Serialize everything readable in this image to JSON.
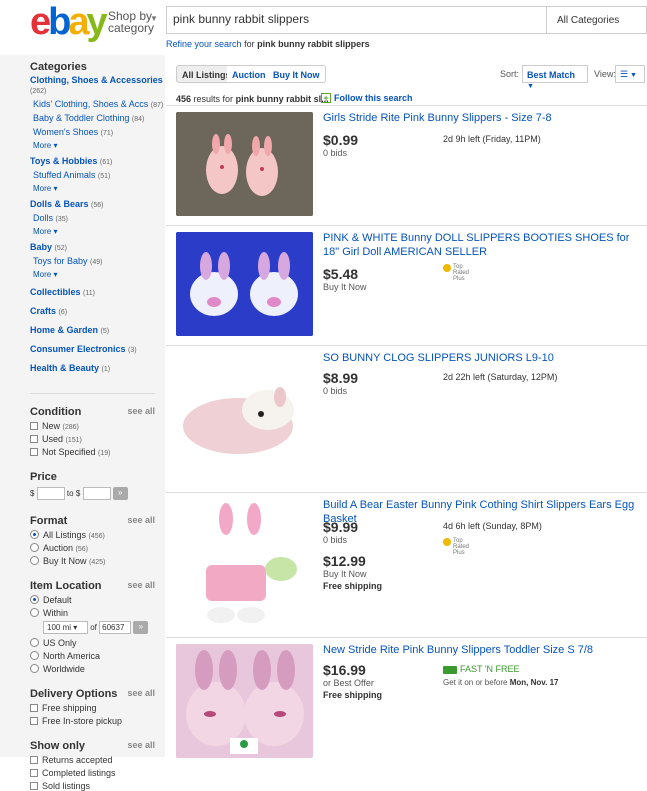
{
  "header": {
    "logo": {
      "e": "e",
      "b": "b",
      "a": "a",
      "y": "y"
    },
    "shop_by": "Shop by",
    "category": "category",
    "search_value": "pink bunny rabbit slippers",
    "category_select": "All Categories",
    "refine_prefix": "Refine your search",
    "refine_for": "for",
    "refine_query": "pink bunny rabbit slippers"
  },
  "sidebar": {
    "categories_heading": "Categories",
    "groups": [
      {
        "label": "Clothing, Shoes & Accessories",
        "count": "(262)",
        "subs": [
          {
            "label": "Kids' Clothing, Shoes & Accs",
            "count": "(87)"
          },
          {
            "label": "Baby & Toddler Clothing",
            "count": "(84)"
          },
          {
            "label": "Women's Shoes",
            "count": "(71)"
          }
        ],
        "more": "More"
      },
      {
        "label": "Toys & Hobbies",
        "count": "(61)",
        "subs": [
          {
            "label": "Stuffed Animals",
            "count": "(51)"
          }
        ],
        "more": "More"
      },
      {
        "label": "Dolls & Bears",
        "count": "(56)",
        "subs": [
          {
            "label": "Dolls",
            "count": "(35)"
          }
        ],
        "more": "More"
      },
      {
        "label": "Baby",
        "count": "(52)",
        "subs": [
          {
            "label": "Toys for Baby",
            "count": "(49)"
          }
        ],
        "more": "More"
      }
    ],
    "flat_categories": [
      {
        "label": "Collectibles",
        "count": "(11)"
      },
      {
        "label": "Crafts",
        "count": "(6)"
      },
      {
        "label": "Home & Garden",
        "count": "(5)"
      },
      {
        "label": "Consumer Electronics",
        "count": "(3)"
      },
      {
        "label": "Health & Beauty",
        "count": "(1)"
      }
    ],
    "see_all": "see all",
    "condition": {
      "heading": "Condition",
      "options": [
        {
          "label": "New",
          "count": "(286)"
        },
        {
          "label": "Used",
          "count": "(151)"
        },
        {
          "label": "Not Specified",
          "count": "(19)"
        }
      ]
    },
    "price": {
      "heading": "Price",
      "from": "$",
      "to": "to $"
    },
    "format": {
      "heading": "Format",
      "options": [
        {
          "label": "All Listings",
          "count": "(456)"
        },
        {
          "label": "Auction",
          "count": "(56)"
        },
        {
          "label": "Buy It Now",
          "count": "(425)"
        }
      ]
    },
    "location": {
      "heading": "Item Location",
      "default": "Default",
      "within": "Within",
      "distance": "100 mi",
      "of": "of",
      "zip": "60637",
      "options": [
        "US Only",
        "North America",
        "Worldwide"
      ]
    },
    "delivery": {
      "heading": "Delivery Options",
      "options": [
        "Free shipping",
        "Free In-store pickup"
      ]
    },
    "show_only": {
      "heading": "Show only",
      "options": [
        "Returns accepted",
        "Completed listings",
        "Sold listings"
      ]
    }
  },
  "toolbar": {
    "tabs": [
      "All Listings",
      "Auction",
      "Buy It Now"
    ],
    "sort_label": "Sort:",
    "sort_value": "Best Match",
    "view_label": "View:",
    "results_count": "456",
    "results_text": "results for",
    "results_query": "pink bunny rabbit sl...",
    "follow": "Follow this search"
  },
  "items": [
    {
      "title": "Girls Stride Rite Pink Bunny Slippers - Size 7-8",
      "price": "$0.99",
      "sub": "0 bids",
      "time": "2d 9h left (Friday, 11PM)"
    },
    {
      "title": "PINK & WHITE Bunny DOLL SLIPPERS BOOTIES SHOES for 18\" Girl Doll AMERICAN SELLER",
      "price": "$5.48",
      "sub": "Buy It Now",
      "badge": "Top Rated Plus"
    },
    {
      "title": "SO BUNNY CLOG SLIPPERS JUNIORS L9-10",
      "price": "$8.99",
      "sub": "0 bids",
      "time": "2d 22h left (Saturday, 12PM)"
    },
    {
      "title": "Build A Bear Easter Bunny Pink Cothing Shirt Slippers Ears Egg Basket",
      "price": "$9.99",
      "sub": "0 bids",
      "time": "4d 6h left (Sunday, 8PM)",
      "badge": "Top Rated Plus",
      "price2": "$12.99",
      "sub2": "Buy It Now",
      "shipping": "Free shipping"
    },
    {
      "title": "New Stride Rite Pink Bunny Slippers Toddler Size S 7/8",
      "price": "$16.99",
      "sub": "or Best Offer",
      "shipping": "Free shipping",
      "fast": "FAST 'N FREE",
      "getit": "Get it on or before",
      "getit_date": "Mon, Nov. 17"
    }
  ]
}
